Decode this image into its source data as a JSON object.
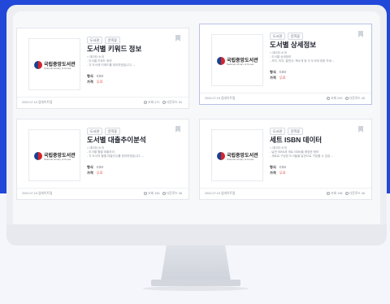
{
  "cards": [
    {
      "logo": "국립중앙도서관",
      "logo_sub": "National Library of Korea",
      "tag1": "도서관",
      "tag2": "문학류",
      "title": "도서별 키워드 정보",
      "desc1": "= 데이터 소개",
      "desc2": "- 도서별 키워드 정보",
      "desc3": "- 각 도서에 키워드를 정리하였습니다. --",
      "format_label": "형식",
      "format": "CSV",
      "price_label": "가격",
      "price": "무료",
      "date": "2020.07.15 업데이트됨",
      "views": "조회 271",
      "downloads": "다운로드 54"
    },
    {
      "logo": "국립중앙도서관",
      "logo_sub": "National Library of Korea",
      "tag1": "도서관",
      "tag2": "문학류",
      "title": "도서별 상세정보",
      "desc1": "= 데이터 소개",
      "desc2": "- 도서별 상세정보",
      "desc3": "- 저자, 저자, 출판사, 책소개 등 각 도서에 대한 자세 --",
      "format_label": "형식",
      "format": "CSV",
      "price_label": "가격",
      "price": "무료",
      "date": "2020.07.15 업데이트됨",
      "views": "조회 200",
      "downloads": "다운로드 45"
    },
    {
      "logo": "국립중앙도서관",
      "logo_sub": "National Library of Korea",
      "tag1": "도서관",
      "tag2": "문학류",
      "title": "도서별 대출추이분석",
      "desc1": "= 데이터 소개",
      "desc2": "- 도서별 월별 대출추이",
      "desc3": "- 각 도서의 월별 대출건수를 정리하였습니다. --",
      "format_label": "형식",
      "format": "CSV",
      "price_label": "가격",
      "price": "무료",
      "date": "2020.07.15 업데이트됨",
      "views": "조회 183",
      "downloads": "다운로드 38"
    },
    {
      "logo": "국립중앙도서관",
      "logo_sub": "National Library of Korea",
      "tag1": "도서관",
      "tag2": "문학류",
      "title": "세트 ISBN 데이터",
      "desc1": "= 데이터 소개",
      "desc2": "- 낱권 ISBN과 세트 ISBN을 매칭한 정보",
      "desc3": "- 세트로 구성된 도서들을 낱권으로 구분할 수 있습 --",
      "format_label": "형식",
      "format": "CSV",
      "price_label": "가격",
      "price": "무료",
      "date": "2020.07.15 업데이트됨",
      "views": "조회 198",
      "downloads": "다운로드 38"
    }
  ],
  "icons": {
    "bookmark": "bookmark-icon",
    "views": "person-icon",
    "downloads": "download-icon"
  },
  "colors": {
    "background_accent": "#2148d8",
    "price": "#e04848",
    "active_border": "#b9c2e6"
  }
}
